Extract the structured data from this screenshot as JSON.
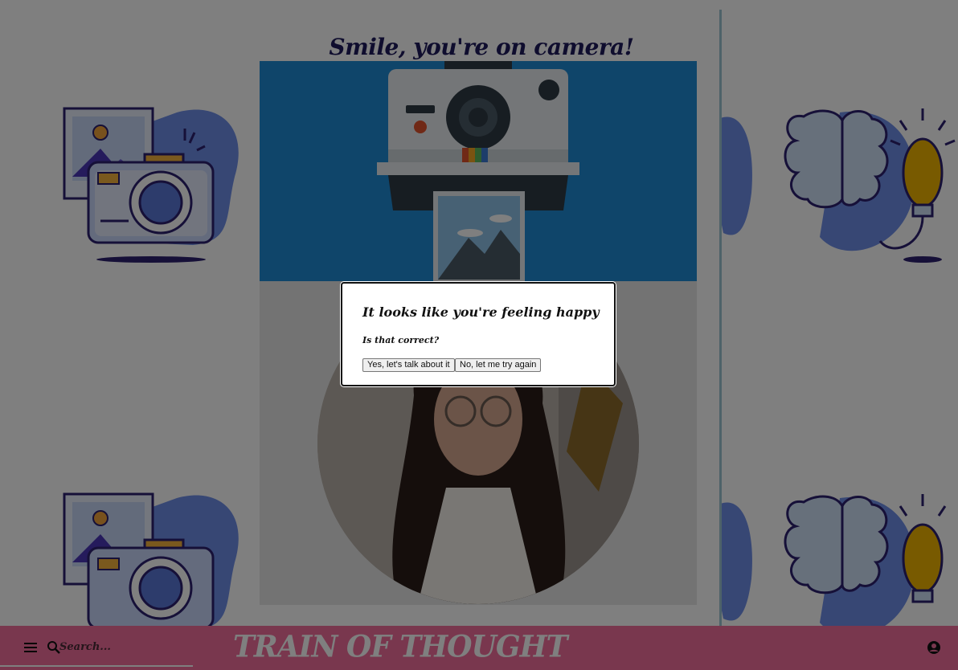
{
  "page": {
    "title": "Smile, you're on camera!"
  },
  "navbar": {
    "brand": "TRAIN OF THOUGHT",
    "search_placeholder": "Search...",
    "icons": [
      "menu-icon",
      "search-icon",
      "account-circle-icon"
    ]
  },
  "dialog": {
    "heading": "It looks like you're feeling happy",
    "question": "Is that correct?",
    "yes_label": "Yes, let's talk about it",
    "no_label": "No, let me try again"
  },
  "colors": {
    "navbar": "#f26f9c",
    "title": "#1f1a5c",
    "hero_bg": "#1f8ad4",
    "panel_border": "#9dc4d3"
  }
}
